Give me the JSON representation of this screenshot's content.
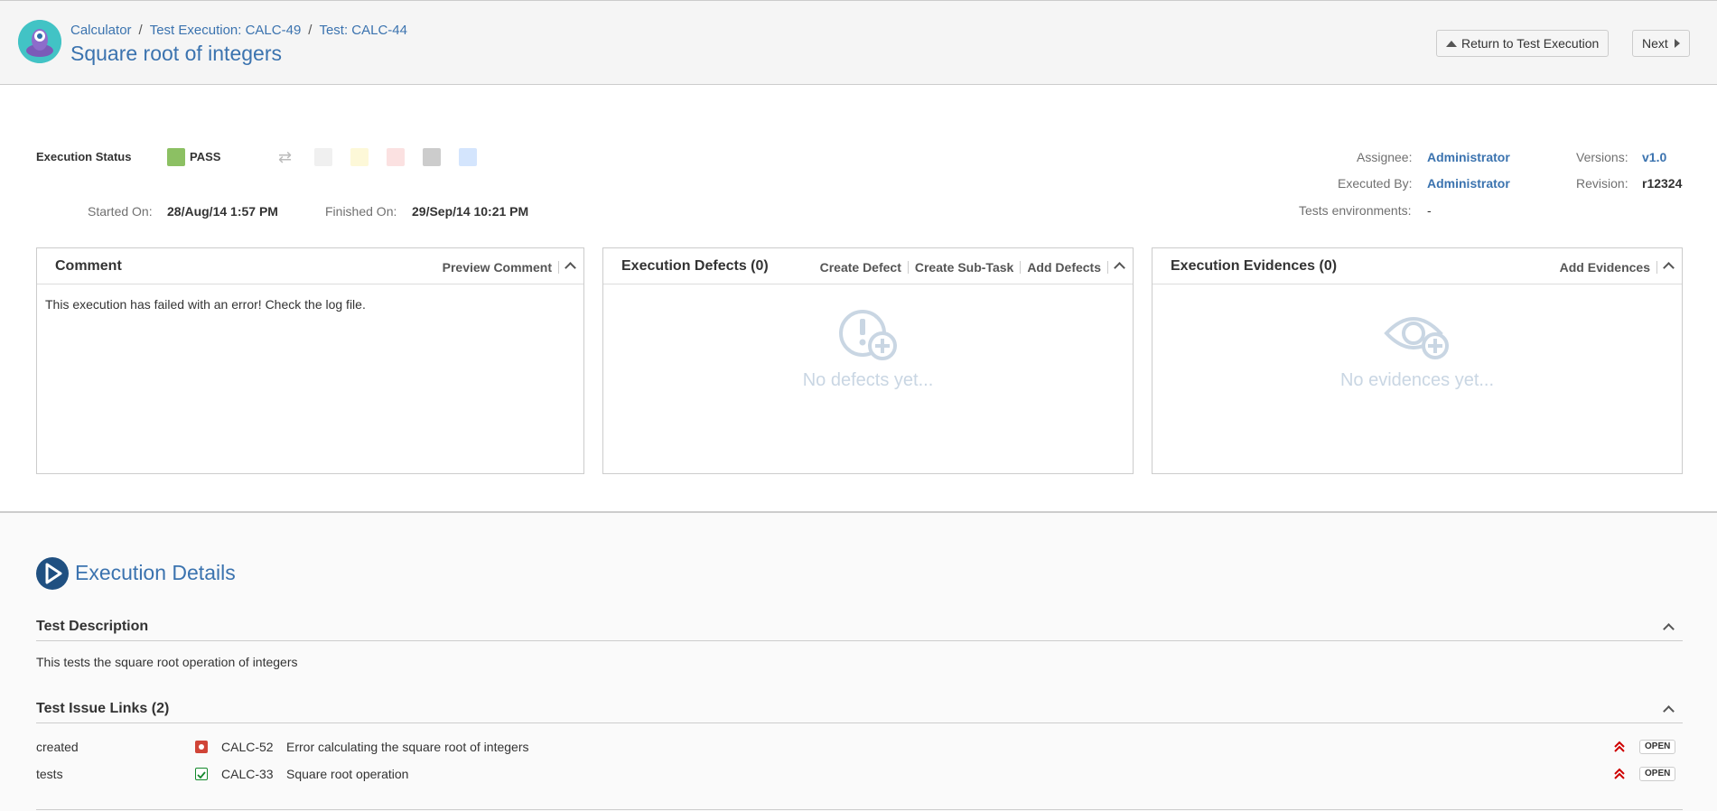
{
  "header": {
    "breadcrumbs": [
      "Calculator",
      "Test Execution: CALC-49",
      "Test: CALC-44"
    ],
    "separator": "/",
    "title": "Square root of integers",
    "return_button": "Return to Test Execution",
    "next_button": "Next"
  },
  "execution": {
    "status_label": "Execution Status",
    "status_value": "PASS",
    "status_color": "#8cc063",
    "status_options": [
      {
        "name": "todo",
        "color": "#f0f0f0"
      },
      {
        "name": "executing",
        "color": "#fdf8d8"
      },
      {
        "name": "fail",
        "color": "#fbe1e1"
      },
      {
        "name": "aborted",
        "color": "#cccccc"
      },
      {
        "name": "custom",
        "color": "#d4e5fd"
      }
    ],
    "started_label": "Started On:",
    "started_value": "28/Aug/14 1:57 PM",
    "finished_label": "Finished On:",
    "finished_value": "29/Sep/14 10:21 PM",
    "assignee_label": "Assignee:",
    "assignee_value": "Administrator",
    "executed_by_label": "Executed By:",
    "executed_by_value": "Administrator",
    "environments_label": "Tests environments:",
    "environments_value": "-",
    "versions_label": "Versions:",
    "versions_value": "v1.0",
    "revision_label": "Revision:",
    "revision_value": "r12324"
  },
  "comment_panel": {
    "title": "Comment",
    "action": "Preview Comment",
    "text": "This execution has failed with an error! Check the log file."
  },
  "defects_panel": {
    "title": "Execution Defects (0)",
    "actions": [
      "Create Defect",
      "Create Sub-Task",
      "Add Defects"
    ],
    "empty_text": "No defects yet...",
    "icon": "defect-add-icon"
  },
  "evidences_panel": {
    "title": "Execution Evidences (0)",
    "action": "Add Evidences",
    "empty_text": "No evidences yet...",
    "icon": "evidence-add-icon"
  },
  "details": {
    "title": "Execution Details",
    "description_title": "Test Description",
    "description_text": "This tests the square root operation of integers",
    "links_title": "Test Issue Links (2)",
    "links": [
      {
        "relation": "created",
        "key": "CALC-52",
        "summary": "Error calculating the square root of integers",
        "type_icon": "bug-icon",
        "priority_icon": "priority-highest-icon",
        "status": "OPEN"
      },
      {
        "relation": "tests",
        "key": "CALC-33",
        "summary": "Square root operation",
        "type_icon": "story-icon",
        "priority_icon": "priority-highest-icon",
        "status": "OPEN"
      }
    ]
  },
  "colors": {
    "link": "#3b73af",
    "bug": "#d04437",
    "story": "#14892c",
    "priority": "#ce0000",
    "empty_state": "#c9d6e3"
  }
}
